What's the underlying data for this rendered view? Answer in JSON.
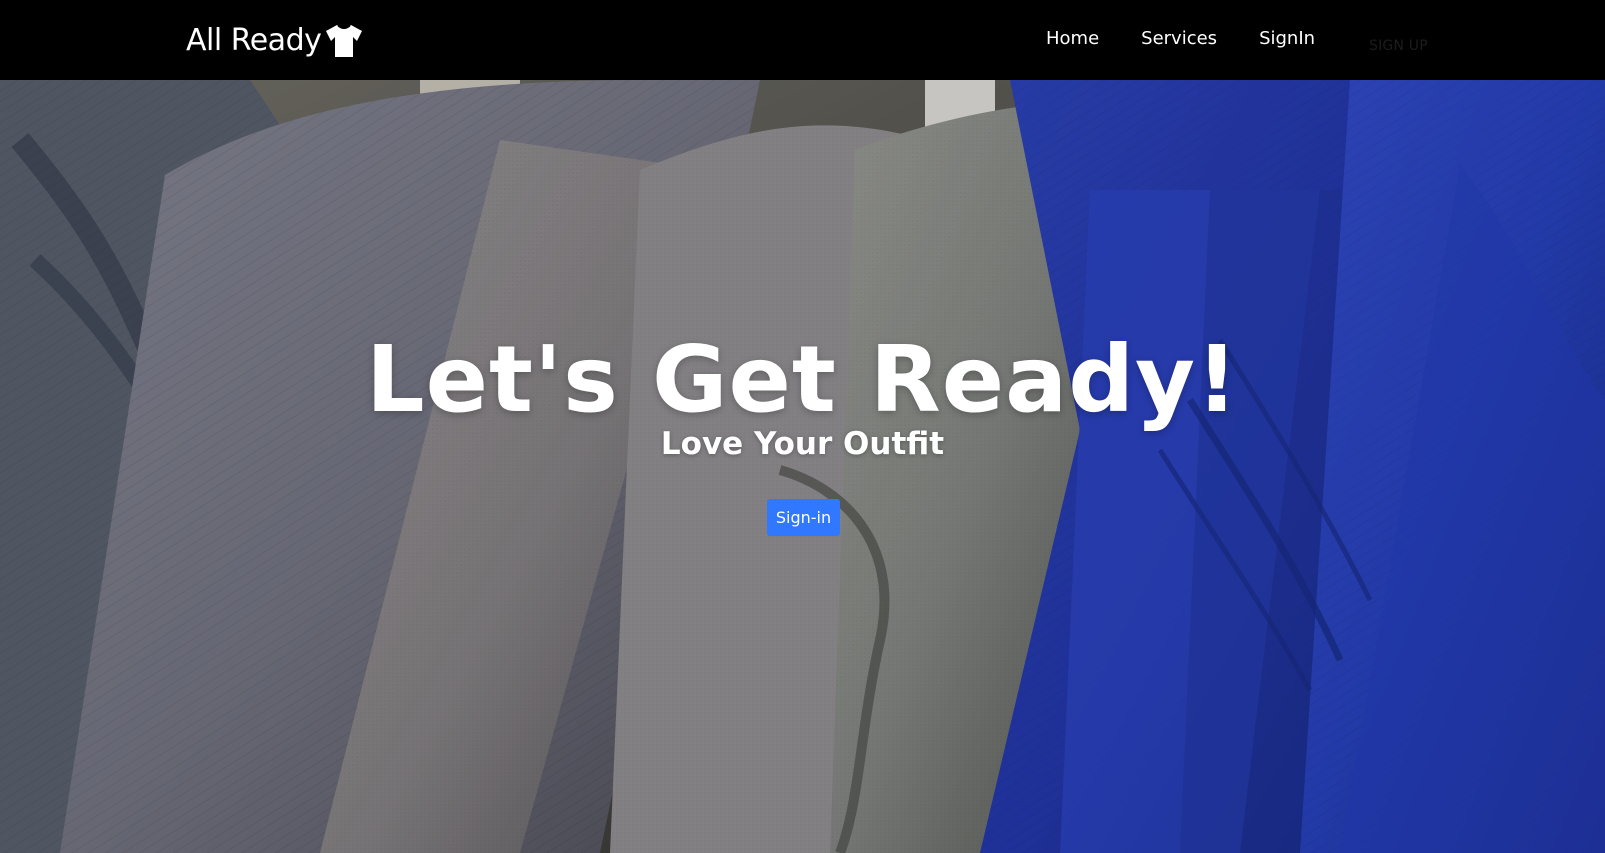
{
  "navbar": {
    "brand": "All Ready",
    "links": [
      "Home",
      "Services",
      "SignIn"
    ],
    "signup": "SIGN UP"
  },
  "hero": {
    "title": "Let's Get Ready!",
    "subtitle": "Love Your Outfit",
    "button": "Sign-in"
  },
  "colors": {
    "nav_bg": "#000000",
    "button_bg": "#2f78ff"
  }
}
